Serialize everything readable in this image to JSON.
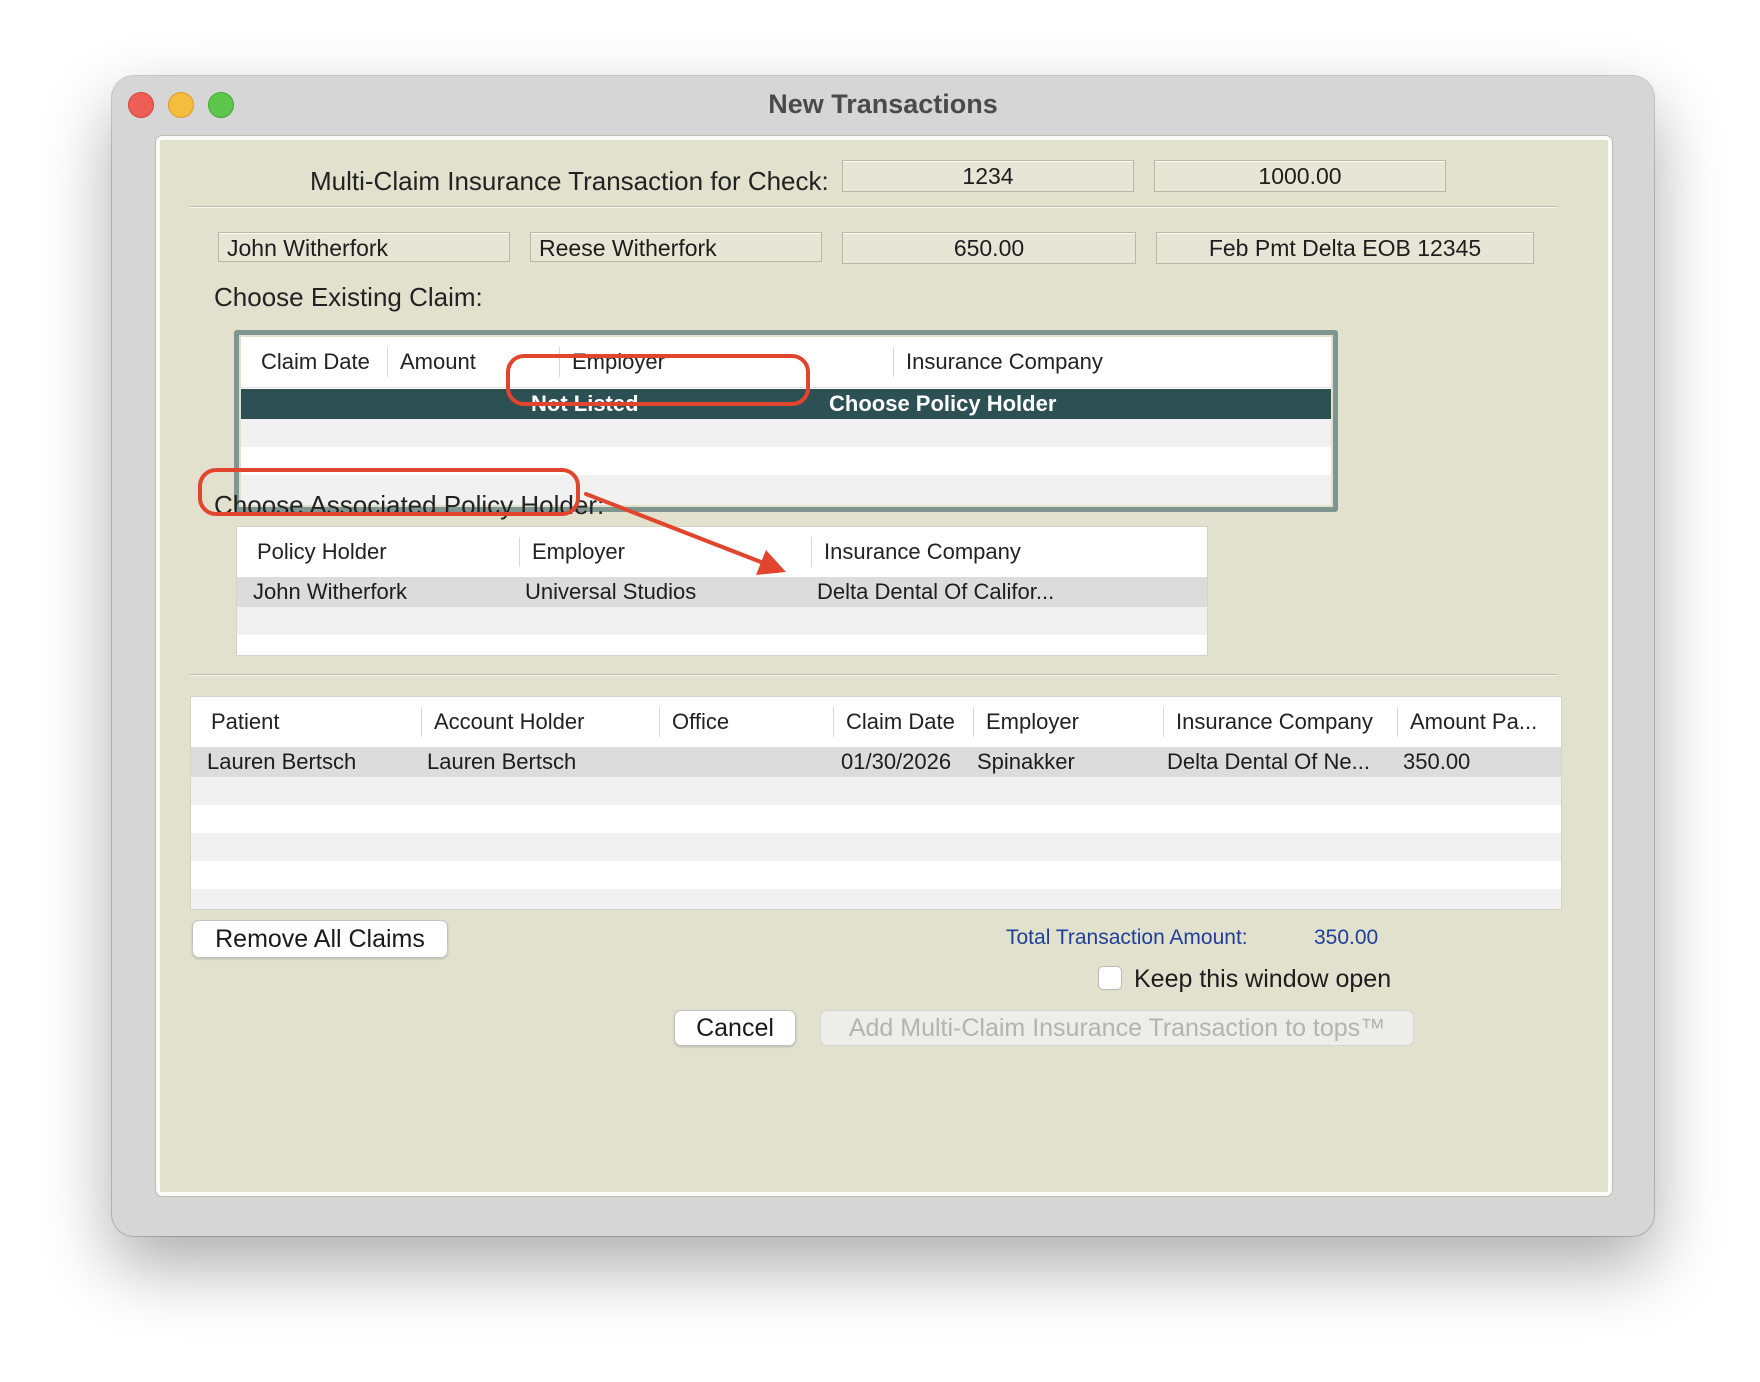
{
  "window": {
    "title": "New Transactions",
    "header_label": "Multi-Claim Insurance Transaction for Check:",
    "check_number": "1234",
    "check_amount": "1000.00"
  },
  "transaction": {
    "account_holder": "John Witherfork",
    "patient": "Reese Witherfork",
    "amount": "650.00",
    "memo": "Feb Pmt Delta EOB 12345"
  },
  "existing_claim": {
    "label": "Choose Existing Claim:",
    "columns": [
      "Claim Date",
      "Amount",
      "Employer",
      "Insurance Company"
    ],
    "rows": [
      {
        "claim_date": "",
        "amount": "",
        "employer": "Not Listed",
        "insurance_company": "Choose Policy Holder"
      }
    ]
  },
  "policy_holder": {
    "label": "Choose Associated Policy Holder:",
    "columns": [
      "Policy Holder",
      "Employer",
      "Insurance Company"
    ],
    "rows": [
      {
        "policy_holder": "John Witherfork",
        "employer": "Universal Studios",
        "insurance_company": "Delta Dental Of Califor..."
      }
    ]
  },
  "claims_table": {
    "columns": [
      "Patient",
      "Account Holder",
      "Office",
      "Claim Date",
      "Employer",
      "Insurance Company",
      "Amount Pa..."
    ],
    "rows": [
      {
        "patient": "Lauren Bertsch",
        "account_holder": "Lauren Bertsch",
        "office": "",
        "claim_date": "01/30/2026",
        "employer": "Spinakker",
        "insurance_company": "Delta Dental Of Ne...",
        "amount_paid": "350.00"
      }
    ]
  },
  "footer": {
    "remove_all_label": "Remove All Claims",
    "total_label": "Total Transaction Amount:",
    "total_value": "350.00",
    "keep_open_label": "Keep this window open",
    "keep_open_checked": false,
    "cancel_label": "Cancel",
    "add_label": "Add Multi-Claim Insurance Transaction to tops™",
    "add_enabled": false
  },
  "colors": {
    "content_bg": "#e1e1cd",
    "selection": "#2d5055",
    "total_text": "#1f3f9a",
    "annotation": "#e2452d"
  }
}
